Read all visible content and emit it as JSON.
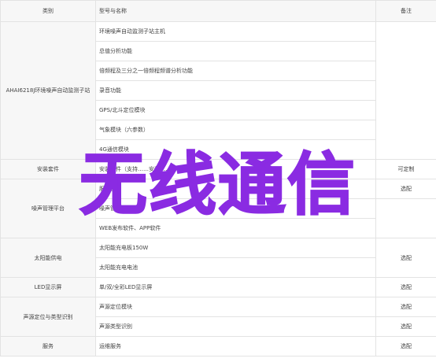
{
  "header": {
    "category": "类别",
    "name": "型号与名称",
    "note": "备注"
  },
  "rows": [
    {
      "category": "AHAI6218J环境噪声自动监测子站",
      "name": "环境噪声自动监测子站主机",
      "note": ""
    },
    {
      "category": "",
      "name": "总值分析功能",
      "note": ""
    },
    {
      "category": "",
      "name": "倍频程及三分之一倍频程频谱分析功能",
      "note": ""
    },
    {
      "category": "",
      "name": "录音功能",
      "note": ""
    },
    {
      "category": "",
      "name": "GPS/北斗定位模块",
      "note": ""
    },
    {
      "category": "",
      "name": "气象模块（六参数）",
      "note": ""
    },
    {
      "category": "",
      "name": "4G通信模块",
      "note": ""
    },
    {
      "category": "安装套件",
      "name": "安装套件（支持……安装……）",
      "note": "可定制"
    },
    {
      "category": "噪声管理平台",
      "name": "服务器",
      "note": "选配"
    },
    {
      "category": "",
      "name": "噪声管理平台",
      "note": ""
    },
    {
      "category": "",
      "name": "WEB发布软件、APP软件",
      "note": ""
    },
    {
      "category": "太阳能供电",
      "name": "太阳能充电板150W",
      "note": "选配"
    },
    {
      "category": "",
      "name": "太阳能充电电池",
      "note": ""
    },
    {
      "category": "LED显示屏",
      "name": "单/双/全彩LED显示屏",
      "note": "选配"
    },
    {
      "category": "声源定位与类型识别",
      "name": "声源定位模块",
      "note": "选配"
    },
    {
      "category": "",
      "name": "声源类型识别",
      "note": "选配"
    },
    {
      "category": "服务",
      "name": "运维服务",
      "note": "选配"
    }
  ],
  "overlay_text": "无线通信"
}
